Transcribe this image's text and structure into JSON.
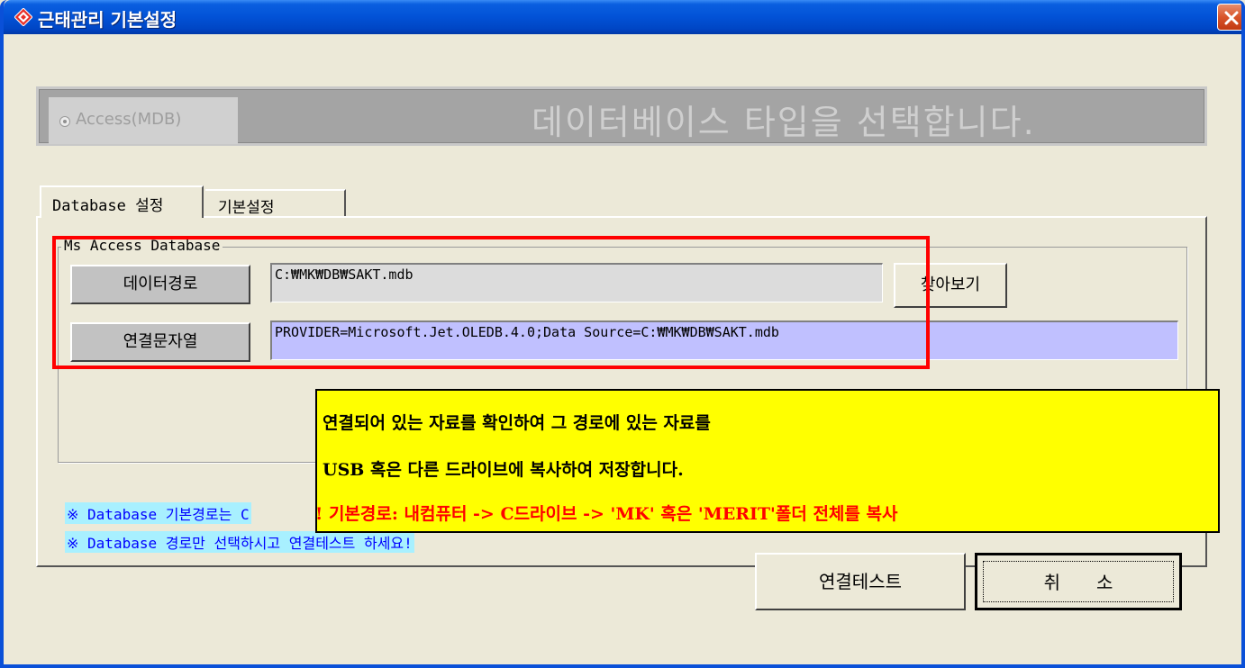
{
  "window": {
    "title": "근태관리 기본설정",
    "icon": "app-diamond-icon",
    "close_icon": "close-icon",
    "accent": "#0a50d8"
  },
  "banner": {
    "radio_label": "Access(MDB)",
    "radio_selected": true,
    "text": "데이터베이스 타입을 선택합니다."
  },
  "tabs": [
    {
      "label": "Database 설정",
      "active": true
    },
    {
      "label": "기본설정",
      "active": false
    }
  ],
  "group": {
    "legend": "Ms Access Database",
    "path_button": "데이터경로",
    "path_value": "C:₩MK₩DB₩SAKT.mdb",
    "browse_button": "찾아보기",
    "conn_button": "연결문자열",
    "conn_value": "PROVIDER=Microsoft.Jet.OLEDB.4.0;Data Source=C:₩MK₩DB₩SAKT.mdb"
  },
  "notes": [
    "※ Database 기본경로는 C",
    "※ Database 경로만 선택하시고 연결테스트 하세요!"
  ],
  "callout": {
    "line1": "연결되어 있는 자료를 확인하여 그 경로에 있는 자료를",
    "line2": "USB 혹은 다른 드라이브에 복사하여 저장합니다.",
    "line3": "! 기본경로: 내컴퓨터 -> C드라이브 -> 'MK' 혹은 'MERIT'폴더 전체를 복사",
    "bg_color": "#ffff00",
    "warning_color": "#ff0000"
  },
  "actions": {
    "test_button": "연결테스트",
    "cancel_button": "취소"
  }
}
